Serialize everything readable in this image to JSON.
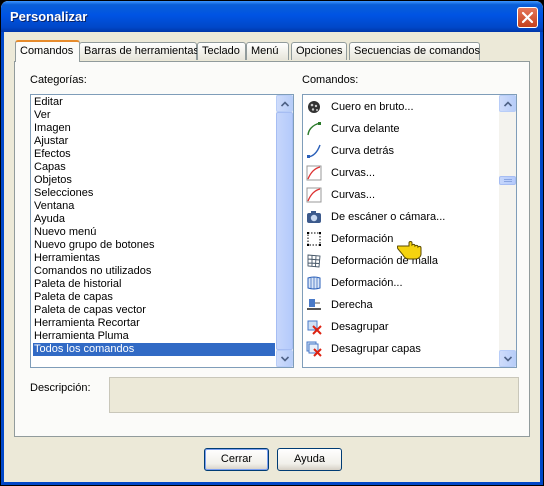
{
  "window": {
    "title": "Personalizar"
  },
  "tabs": [
    {
      "label": "Comandos",
      "active": true
    },
    {
      "label": "Barras de herramientas"
    },
    {
      "label": "Teclado"
    },
    {
      "label": "Menú"
    },
    {
      "label": "Opciones"
    },
    {
      "label": "Secuencias de comandos"
    }
  ],
  "categories": {
    "label": "Categorías:",
    "items": [
      "Editar",
      "Ver",
      "Imagen",
      "Ajustar",
      "Efectos",
      "Capas",
      "Objetos",
      "Selecciones",
      "Ventana",
      "Ayuda",
      "Nuevo menú",
      "Nuevo grupo de botones",
      "Herramientas",
      "Comandos no utilizados",
      "Paleta de historial",
      "Paleta de capas",
      "Paleta de capas vector",
      "Herramienta Recortar",
      "Herramienta Pluma",
      "Todos los comandos"
    ],
    "selected": "Todos los comandos"
  },
  "commands": {
    "label": "Comandos:",
    "items": [
      {
        "label": "Cuero en bruto...",
        "icon": "leather-icon"
      },
      {
        "label": "Curva delante",
        "icon": "curve-front-icon"
      },
      {
        "label": "Curva detrás",
        "icon": "curve-back-icon"
      },
      {
        "label": "Curvas...",
        "icon": "curves-icon"
      },
      {
        "label": "Curvas...",
        "icon": "curves-icon"
      },
      {
        "label": "De escáner o cámara...",
        "icon": "camera-icon"
      },
      {
        "label": "Deformación",
        "icon": "deform-icon"
      },
      {
        "label": "Deformación de malla",
        "icon": "mesh-warp-icon"
      },
      {
        "label": "Deformación...",
        "icon": "warp-icon"
      },
      {
        "label": "Derecha",
        "icon": "align-right-icon"
      },
      {
        "label": "Desagrupar",
        "icon": "ungroup-icon"
      },
      {
        "label": "Desagrupar capas",
        "icon": "ungroup-layers-icon"
      }
    ]
  },
  "description": {
    "label": "Descripción:",
    "value": ""
  },
  "buttons": {
    "close": "Cerrar",
    "help": "Ayuda"
  }
}
